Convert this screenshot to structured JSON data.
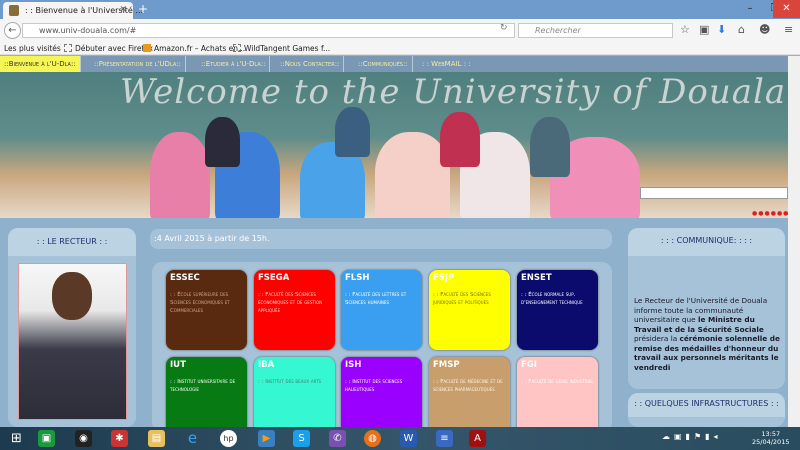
{
  "browser": {
    "tab_title": ": : Bienvenue à l'Université ...",
    "url": "www.univ-douala.com/#",
    "search_placeholder": "Rechercher",
    "bookmarks": [
      "Les plus visités",
      "Débuter avec Firefox",
      "Amazon.fr – Achats en...",
      "WildTangent Games f..."
    ]
  },
  "site": {
    "menu": [
      "::Bienvenue à l'U-Dla::",
      "::Présentatation de l'UDla::",
      "::Etudier à l'U-Dla::",
      "::Nous Contacter::",
      "::Communiqués::",
      ": : WebMAIL : :"
    ],
    "banner_title": "Welcome to the University of Douala",
    "recteur_title": ": : LE RECTEUR : :",
    "date_line": ":4 Avril 2015 à partir de 15h.",
    "faculties": [
      {
        "code": "ESSEC",
        "desc": ": : École supérieure des Sciences économiques et Commerciales",
        "color": "#5a2a10",
        "text": "#c9a88a"
      },
      {
        "code": "FSEGA",
        "desc": ": : Faculté des Sciences économiques et de gestion appliquée",
        "color": "#ff0000",
        "text": "#ffd0c0"
      },
      {
        "code": "FLSH",
        "desc": ": : Faculté des lettres et Sciences humaines",
        "color": "#3a9ff0",
        "text": "#ffffff"
      },
      {
        "code": "FSJP",
        "desc": ": : Faculté des Sciences juridiques et politiques",
        "color": "#ffff00",
        "text": "#777700"
      },
      {
        "code": "ENSET",
        "desc": ": : École normale sup. d'enseignement technique",
        "color": "#0b0b6e",
        "text": "#ffffff"
      },
      {
        "code": "IUT",
        "desc": ": : Institut universitaire de technologie",
        "color": "#087a14",
        "text": "#ffffff"
      },
      {
        "code": "IBA",
        "desc": ": : Institut des beaux arts",
        "color": "#35f8d2",
        "text": "#557777"
      },
      {
        "code": "ISH",
        "desc": ": : Institut des sciences halieutiques",
        "color": "#9a00ff",
        "text": "#ffffff"
      },
      {
        "code": "FMSP",
        "desc": ": : Faculté de médecine et de sciences pharmaceutiques",
        "color": "#c89e6c",
        "text": "#fff3e0"
      },
      {
        "code": "FGI",
        "desc": ": : Faculté de génie industriel",
        "color": "#ffc4c4",
        "text": "#ffffff"
      }
    ],
    "communique_title": ": : : COMMUNIQUE: : : :",
    "communique_plain1": "Le Recteur de l'Université de Douala informe toute la communauté universitaire que ",
    "communique_bold1": "le Ministre du Travail et de la Sécurité Sociale",
    "communique_plain2": " présidera la ",
    "communique_bold2": "cérémonie solennelle de remise des médailles d'honneur du travail aux personnels méritants le vendredi",
    "infra_title": ": : QUELQUES INFRASTRUCTURES : :"
  },
  "taskbar": {
    "time": "13:57",
    "date": "25/04/2015"
  }
}
